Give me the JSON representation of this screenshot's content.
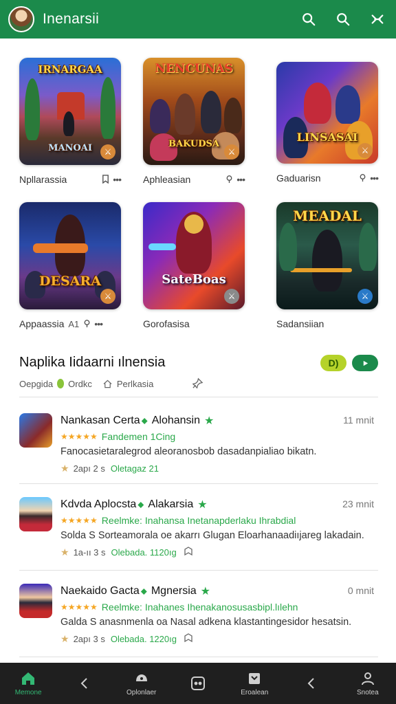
{
  "header": {
    "title": "Inenarsii",
    "bg_color": "#1b8a4b",
    "icons": [
      "search-icon",
      "search-icon",
      "close-icon"
    ]
  },
  "games": [
    {
      "art_title": "IRNARGAA",
      "art_subtitle": "MANOAI",
      "name": "Npllarassia",
      "icon": "bookmark-icon"
    },
    {
      "art_title": "NENCUNAS",
      "art_subtitle": "BAKUDSA",
      "name": "Aphleasian",
      "icon": "location-icon"
    },
    {
      "art_title": "LINSASAI",
      "art_subtitle": "",
      "name": "Gaduarisn",
      "icon": "location-icon"
    },
    {
      "art_title": "DESARA",
      "art_subtitle": "",
      "name": "Appaassia",
      "count": "A1",
      "icon": "location-icon"
    },
    {
      "art_title": "SateBoas",
      "art_subtitle": "",
      "name": "Gorofasisa",
      "icon": ""
    },
    {
      "art_title": "MEADAL",
      "art_subtitle": "",
      "name": "Sadansiian",
      "icon": ""
    }
  ],
  "section": {
    "title": "Naplika Iidaarni ılnensia",
    "sub_left": "Oepgida",
    "sub_mid": "Ordkc",
    "sub_right": "Perlkasia",
    "chip_label": "D)"
  },
  "reviews": [
    {
      "name": "Nankasan Certa",
      "tag": "Alohansin",
      "time": "11 mnit",
      "stars": "★★★★★",
      "note": "Fandemen 1Cing",
      "text": "Fanocasietaralegrod aleoranosbob dasadanpialiao bikatn.",
      "meta_count": "2apı 2 s",
      "meta_green": "Oletagaz 21",
      "meta_icon": ""
    },
    {
      "name": "Kdvda Aplocsta",
      "tag": "Alakarsia",
      "time": "23 mnit",
      "stars": "★★★★★",
      "note": "Reelmke: Inahansa Inetanapderlaku Ihrabdial",
      "text": "Solda S Sorteamorala oe akarrı Glugan Eloarhanaadiıjareg lakadain.",
      "meta_count": "1a-ıı 3 s",
      "meta_green": "Olebada. 1120ıg",
      "meta_icon": "shield-icon"
    },
    {
      "name": "Naekaido Gacta",
      "tag": "Mgnersia",
      "time": "0 mnit",
      "stars": "★★★★★",
      "note": "Reelmke: Inahanes Ihenakanosusasbipl.lılehn",
      "text": "Galda S anasnmenla oa Nasal adkena klastantingesidor hesatsin.",
      "meta_count": "2apı 3 s",
      "meta_green": "Olebada. 1220ıg",
      "meta_icon": "shield-icon"
    }
  ],
  "bottom_nav": [
    {
      "label": "Memone",
      "icon": "home-icon",
      "active": true
    },
    {
      "label": "",
      "icon": "back-icon"
    },
    {
      "label": "Oplonlaer",
      "icon": "controller-icon"
    },
    {
      "label": "",
      "icon": "gamepad-icon"
    },
    {
      "label": "Eroalean",
      "icon": "tag-icon"
    },
    {
      "label": "",
      "icon": "back-icon"
    },
    {
      "label": "Snotea",
      "icon": "person-icon"
    }
  ]
}
